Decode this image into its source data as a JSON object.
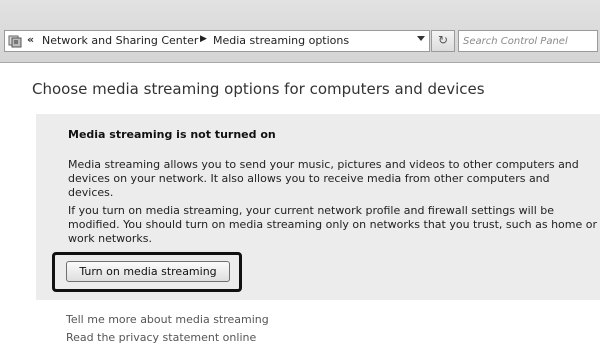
{
  "address_bar": {
    "overflow_chevron": "«",
    "breadcrumbs": [
      {
        "label": "Network and Sharing Center"
      },
      {
        "label": "Media streaming options"
      }
    ],
    "separator_icon": "chevron-right-icon",
    "refresh_glyph": "↻",
    "search_placeholder": "Search Control Panel"
  },
  "page": {
    "heading": "Choose media streaming options for computers and devices"
  },
  "panel": {
    "title": "Media streaming is not turned on",
    "paragraph1": "Media streaming allows you to send your music, pictures and videos to other computers and devices on your network.  It also allows you to receive media from other computers and devices.",
    "paragraph2": "If you turn on media streaming, your current network profile and firewall settings will be modified. You should turn on media streaming only on networks that you trust, such as home or work networks.",
    "button_label": "Turn on media streaming"
  },
  "links": [
    {
      "label": "Tell me more about media streaming"
    },
    {
      "label": "Read the privacy statement online"
    }
  ],
  "colors": {
    "panel_background": "#ececec",
    "highlight_border": "#111111",
    "link_text": "#555555"
  }
}
